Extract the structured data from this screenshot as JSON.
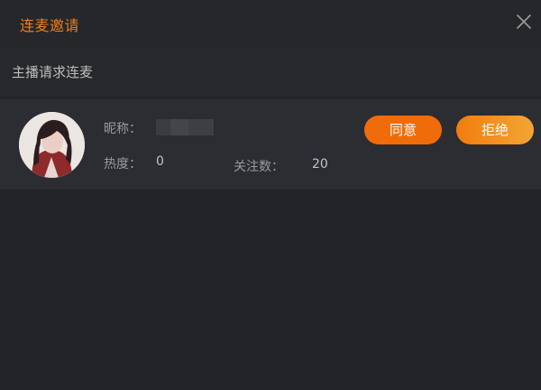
{
  "dialog": {
    "title": "连麦邀请",
    "close_icon": "close-icon",
    "subtitle": "主播请求连麦"
  },
  "request": {
    "nickname_label": "昵称：",
    "nickname_value": "",
    "heat_label": "热度：",
    "heat_value": "0",
    "followers_label": "关注数：",
    "followers_value": "20",
    "agree_label": "同意",
    "reject_label": "拒绝"
  },
  "colors": {
    "accent": "#ef7d1a",
    "agree_bg": "#f06c0a",
    "reject_bg_start": "#f27d0e",
    "reject_bg_end": "#f3a534",
    "background": "#232428"
  }
}
